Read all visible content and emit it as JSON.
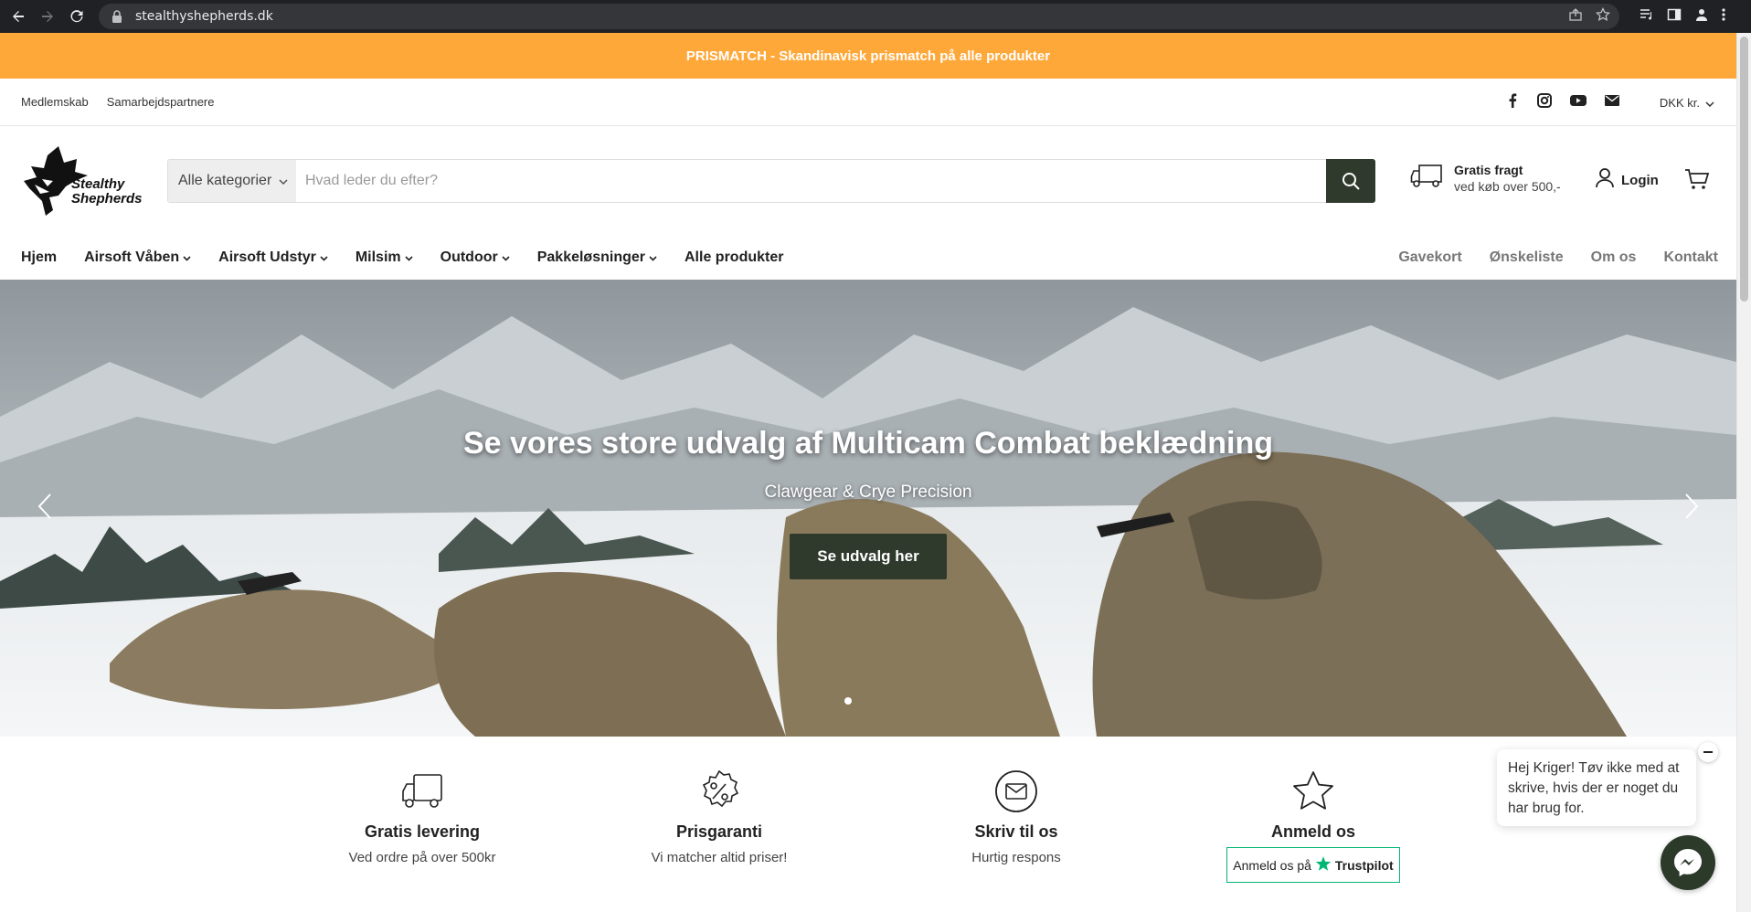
{
  "browser": {
    "url": "stealthyshepherds.dk"
  },
  "announcement": {
    "text": "PRISMATCH - Skandinavisk prismatch på alle produkter"
  },
  "utility": {
    "links": [
      "Medlemskab",
      "Samarbejdspartnere"
    ],
    "social_icons": [
      "facebook-icon",
      "instagram-icon",
      "youtube-icon",
      "mail-icon"
    ],
    "currency": "DKK kr."
  },
  "header": {
    "logo_line1": "Stealthy",
    "logo_line2": "Shepherds",
    "search": {
      "category": "Alle kategorier",
      "placeholder": "Hvad leder du efter?"
    },
    "freight_title": "Gratis fragt",
    "freight_sub": "ved køb over 500,-",
    "login": "Login"
  },
  "nav": {
    "left": [
      {
        "label": "Hjem",
        "dropdown": false
      },
      {
        "label": "Airsoft Våben",
        "dropdown": true
      },
      {
        "label": "Airsoft Udstyr",
        "dropdown": true
      },
      {
        "label": "Milsim",
        "dropdown": true
      },
      {
        "label": "Outdoor",
        "dropdown": true
      },
      {
        "label": "Pakkeløsninger",
        "dropdown": true
      },
      {
        "label": "Alle produkter",
        "dropdown": false
      }
    ],
    "right": [
      "Gavekort",
      "Ønskeliste",
      "Om os",
      "Kontakt"
    ]
  },
  "hero": {
    "title": "Se vores store udvalg af Multicam Combat beklædning",
    "subtitle": "Clawgear & Crye Precision",
    "cta": "Se udvalg her",
    "slide_count": 1,
    "active_slide": 0
  },
  "features": [
    {
      "icon": "truck-icon",
      "title": "Gratis levering",
      "text": "Ved ordre på over 500kr"
    },
    {
      "icon": "percent-badge-icon",
      "title": "Prisgaranti",
      "text": "Vi matcher altid priser!"
    },
    {
      "icon": "envelope-icon",
      "title": "Skriv til os",
      "text": "Hurtig respons"
    },
    {
      "icon": "star-icon",
      "title": "Anmeld os",
      "trustpilot_prefix": "Anmeld os på",
      "trustpilot_brand": "Trustpilot"
    }
  ],
  "chat": {
    "message": "Hej Kriger! Tøv ikke med at skrive, hvis der er noget du har brug for."
  },
  "colors": {
    "announce": "#ffa83a",
    "primary_dark": "#2f3a2c",
    "trustpilot": "#04b674"
  }
}
